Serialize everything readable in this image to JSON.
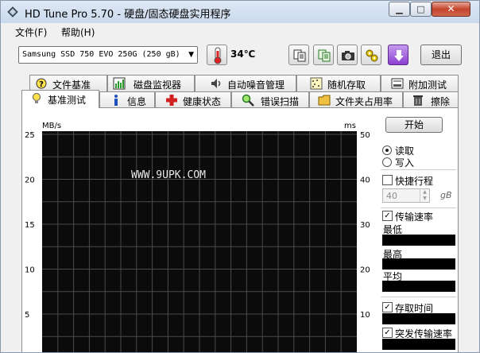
{
  "window": {
    "title": "HD Tune Pro 5.70 - 硬盘/固态硬盘实用程序",
    "minimize_glyph": "▁",
    "maximize_glyph": "□",
    "close_glyph": "✕"
  },
  "menu": {
    "file": "文件(F)",
    "help": "帮助(H)"
  },
  "toolbar": {
    "drive": "Samsung SSD 750 EVO 250G (250 gB)",
    "temperature": "34℃",
    "exit_label": "退出"
  },
  "tabs_top": [
    {
      "label": "文件基准",
      "icon": "file-benchmark-icon"
    },
    {
      "label": "磁盘监视器",
      "icon": "disk-monitor-icon"
    },
    {
      "label": "自动噪音管理",
      "icon": "speaker-icon"
    },
    {
      "label": "随机存取",
      "icon": "random-access-icon"
    },
    {
      "label": "附加测试",
      "icon": "extra-tests-icon"
    }
  ],
  "tabs_bottom": [
    {
      "label": "基准测试",
      "icon": "lightbulb-icon"
    },
    {
      "label": "信息",
      "icon": "info-icon"
    },
    {
      "label": "健康状态",
      "icon": "health-cross-icon"
    },
    {
      "label": "错误扫描",
      "icon": "magnifier-icon"
    },
    {
      "label": "文件夹占用率",
      "icon": "folder-icon"
    },
    {
      "label": "擦除",
      "icon": "trash-icon"
    }
  ],
  "chart_data": {
    "type": "line",
    "ylabel_left": "MB/s",
    "ylabel_right": "ms",
    "y_left_ticks": [
      "25",
      "20",
      "15",
      "10",
      "5"
    ],
    "y_right_ticks": [
      "50",
      "40",
      "30",
      "20",
      "10"
    ],
    "ylim_left": [
      0,
      25
    ],
    "ylim_right": [
      0,
      50
    ],
    "grid": true,
    "series": [],
    "watermark": "WWW.9UPK.COM"
  },
  "controls": {
    "start_label": "开始",
    "read_label": "读取",
    "write_label": "写入",
    "quick_label": "快捷行程",
    "quick_value": "40",
    "quick_unit": "gB",
    "transfer_label": "传输速率",
    "min_label": "最低",
    "max_label": "最高",
    "avg_label": "平均",
    "access_label": "存取时间",
    "burst_label": "突发传输速率",
    "check_mark": "✓"
  }
}
